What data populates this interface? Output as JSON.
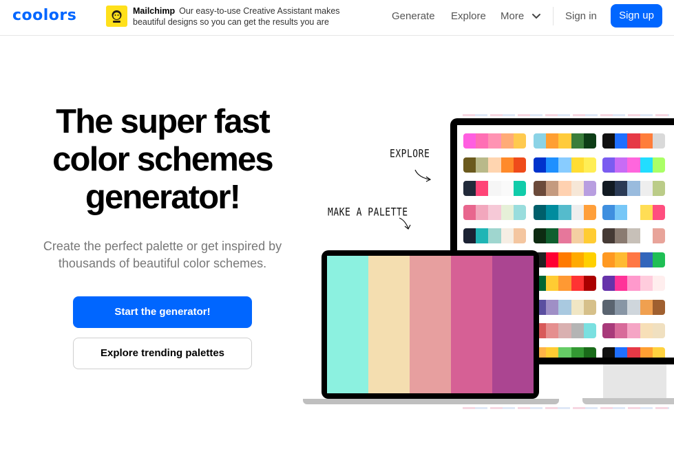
{
  "nav": {
    "logo": "coolors",
    "ad": {
      "brand": "Mailchimp",
      "text": "Our easy-to-use Creative Assistant makes beautiful designs so you can get the results you are"
    },
    "links": [
      "Generate",
      "Explore"
    ],
    "more_label": "More",
    "signin_label": "Sign in",
    "signup_label": "Sign up",
    "accent_color": "#0066ff"
  },
  "hero": {
    "title_lines": [
      "The super fast",
      "color schemes",
      "generator!"
    ],
    "subtitle_lines": [
      "Create the perfect palette or get inspired by",
      "thousands of beautiful color schemes."
    ],
    "primary_button": "Start the generator!",
    "secondary_button": "Explore trending palettes"
  },
  "illustration": {
    "note_explore": "EXPLORE",
    "note_make": "MAKE A PALETTE",
    "laptop_palette": [
      "#8cf1e0",
      "#f4deb0",
      "#e79f9f",
      "#d66095",
      "#ab4591"
    ],
    "monitor_palettes": [
      [
        [
          "#ff5ee0",
          "#ff6fb4",
          "#ff93b3",
          "#ffab77",
          "#ffca4f"
        ],
        [
          "#8bd3e6",
          "#ff9f32",
          "#ffcb3b",
          "#3a7d3a",
          "#0d3d16"
        ],
        [
          "#111111",
          "#1f6fff",
          "#e63946",
          "#ff7d3a",
          "#d9d9d9"
        ]
      ],
      [
        [
          "#6b5a1e",
          "#b9b98a",
          "#ffd5b0",
          "#ff8a2a",
          "#ef4b1a"
        ],
        [
          "#0033cc",
          "#1e90ff",
          "#88ccff",
          "#ffdd33",
          "#ffee55"
        ],
        [
          "#7a5cf0",
          "#c86cf5",
          "#ff66dd",
          "#22ddff",
          "#aaff66"
        ]
      ],
      [
        [
          "#222a3a",
          "#ff4477",
          "#f6f6f6",
          "#fafafa",
          "#11ccaa"
        ],
        [
          "#6b4a3a",
          "#c49a7f",
          "#ffd1b0",
          "#f6e7d7",
          "#b89ee0"
        ],
        [
          "#111a22",
          "#2a3a55",
          "#99bbdd",
          "#eeeeee",
          "#bbcc88"
        ]
      ],
      [
        [
          "#e8668e",
          "#f2a7bd",
          "#f6c9d7",
          "#e6f0d8",
          "#99dddd"
        ],
        [
          "#005f6b",
          "#008c9e",
          "#55bbcc",
          "#eeeeee",
          "#ff9f3a"
        ],
        [
          "#3f8fdf",
          "#77c7f7",
          "#ffffff",
          "#ffdd55",
          "#ff4f7f"
        ]
      ],
      [
        [
          "#1b2233",
          "#1fb5b5",
          "#9fd6cf",
          "#f6eee4",
          "#f4c6a0"
        ],
        [
          "#0d2b12",
          "#0f5f2f",
          "#e6779b",
          "#f4cfa2",
          "#ffcc33"
        ],
        [
          "#453a35",
          "#8a7b71",
          "#c7c0b8",
          "#ffffff",
          "#e8a49a"
        ]
      ],
      [
        [
          "#c8b98a",
          "#c6c6a8",
          "#9fb3ee",
          "#4f7fe0",
          "#2f3fa0"
        ],
        [
          "#222222",
          "#ff0033",
          "#ff7a00",
          "#ffaa00",
          "#ffd000"
        ],
        [
          "#ff9922",
          "#ffbb33",
          "#ff7744",
          "#3366bb",
          "#1fbf55"
        ]
      ],
      [
        [
          "#d65f8f",
          "#ff7aa2",
          "#ffd23f",
          "#3bceac",
          "#0ead69"
        ],
        [
          "#006633",
          "#ffcc33",
          "#ff9933",
          "#ff3333",
          "#aa0000"
        ],
        [
          "#6633aa",
          "#ff3399",
          "#ff99cc",
          "#ffccdd",
          "#ffeeee"
        ]
      ],
      [
        [
          "#5a6aa5",
          "#a38fba",
          "#d7b7d7",
          "#e8e0c8",
          "#c8c09a"
        ],
        [
          "#5b4fa0",
          "#9f8fc6",
          "#a9c9e0",
          "#f0e6c4",
          "#d6c08a"
        ],
        [
          "#5a6470",
          "#8896a5",
          "#cfd6dc",
          "#f0a050",
          "#a06030"
        ]
      ],
      [
        [
          "#c2c2c2",
          "#ff6b6b",
          "#ffa0a0",
          "#ffd0d0",
          "#7cd6d6"
        ],
        [
          "#d85a5a",
          "#e58f8f",
          "#d9b0b0",
          "#b4b4b4",
          "#7ae0e0"
        ],
        [
          "#a83a7a",
          "#d86a9a",
          "#f5a5c5",
          "#f7dfb7",
          "#f0e0c0"
        ]
      ],
      [
        [
          "#ffb347",
          "#ffcc33",
          "#66cc66",
          "#339933",
          "#1a6b1a"
        ],
        [
          "#ffb347",
          "#ffcc33",
          "#66cc66",
          "#339933",
          "#1a6b1a"
        ],
        [
          "#111111",
          "#1f6fff",
          "#e63946",
          "#ff9f32",
          "#ffd23f"
        ]
      ],
      [
        [
          "#3366ff",
          "#6a5acd",
          "#ff66cc",
          "#ff9966",
          "#ffcc00"
        ],
        [
          "#ff5e5b",
          "#d8d8d8",
          "#ffffea",
          "#00cecb",
          "#ffed66"
        ],
        [
          "#6c5ce7",
          "#a29bfe",
          "#fd79a8",
          "#fab1a0",
          "#ffeaa7"
        ]
      ]
    ]
  }
}
